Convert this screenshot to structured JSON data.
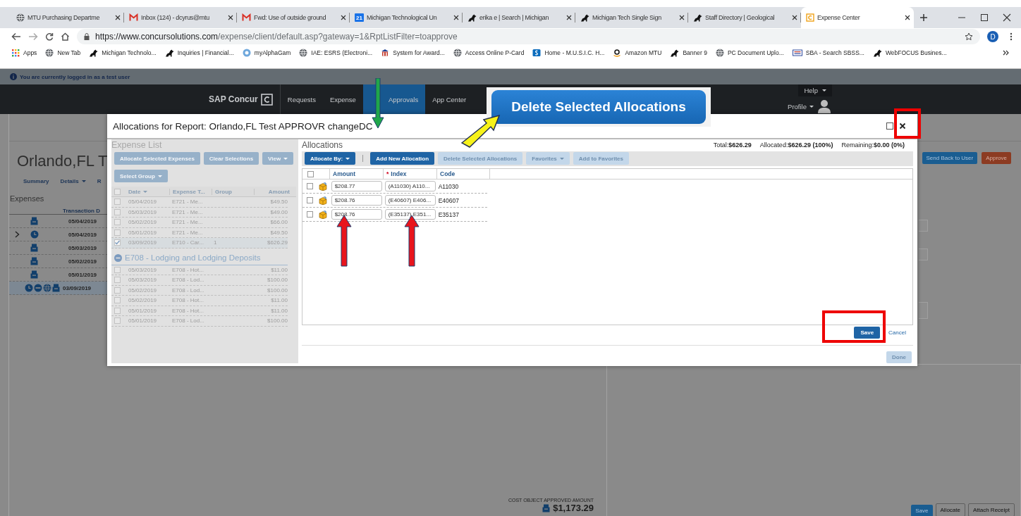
{
  "browser": {
    "tabs": [
      {
        "title": "MTU Purchasing Departme",
        "kind": "globe",
        "selected": false
      },
      {
        "title": "Inbox (124) - dcyrus@mtu",
        "kind": "mail",
        "selected": false
      },
      {
        "title": "Fwd: Use of outside ground",
        "kind": "mail",
        "selected": false
      },
      {
        "title": "Michigan Technological Un",
        "kind": "calendar",
        "badge": "21",
        "selected": false
      },
      {
        "title": "erika e | Search | Michigan",
        "kind": "husky",
        "selected": false
      },
      {
        "title": "Michigan Tech Single Sign",
        "kind": "husky",
        "selected": false
      },
      {
        "title": "Staff Directory | Geological",
        "kind": "husky",
        "selected": false
      },
      {
        "title": "Expense Center",
        "kind": "concur",
        "selected": true
      }
    ],
    "url_host": "https://www.concursolutions.com",
    "url_path": "/expense/client/default.asp?gateway=1&RptListFilter=toapprove",
    "profile_initial": "D",
    "bookmarks": [
      {
        "label": "Apps",
        "kind": "apps"
      },
      {
        "label": "New Tab",
        "kind": "globe"
      },
      {
        "label": "Michigan Technolo...",
        "kind": "husky"
      },
      {
        "label": "Inquiries | Financial...",
        "kind": "husky"
      },
      {
        "label": "myAlphaGam",
        "kind": "badge"
      },
      {
        "label": "IAE: ESRS (Electroni...",
        "kind": "globe"
      },
      {
        "label": "System for Award...",
        "kind": "building"
      },
      {
        "label": "Access Online P-Card",
        "kind": "globe"
      },
      {
        "label": "Home - M.U.S.I.C. H...",
        "kind": "sharepoint"
      },
      {
        "label": "Amazon MTU",
        "kind": "amazon"
      },
      {
        "label": "Banner 9",
        "kind": "husky"
      },
      {
        "label": "PC Document Uplo...",
        "kind": "globe"
      },
      {
        "label": "SBA - Search SBSS...",
        "kind": "sba"
      },
      {
        "label": "WebFOCUS Busines...",
        "kind": "husky"
      }
    ]
  },
  "notice": "You are currently logged in as a test user",
  "nav": {
    "logo": "SAP Concur",
    "items": [
      {
        "label": "Requests",
        "selected": false
      },
      {
        "label": "Expense",
        "selected": false
      },
      {
        "label": "Approvals",
        "selected": true
      },
      {
        "label": "App Center",
        "selected": false
      }
    ],
    "help": "Help",
    "profile": "Profile"
  },
  "report": {
    "title": "Orlando,FL T",
    "tabs": [
      {
        "label": "Summary",
        "dropdown": false
      },
      {
        "label": "Details",
        "dropdown": true
      },
      {
        "label": "R",
        "dropdown": false
      }
    ],
    "actions": [
      {
        "label": "Send Back to User",
        "kind": "primary"
      },
      {
        "label": "Approve",
        "kind": "danger"
      }
    ],
    "section": "Expenses",
    "column": "Transaction D",
    "rows": [
      {
        "date": "05/04/2019",
        "icons": [
          {
            "kind": "receipt"
          }
        ],
        "expandable": false,
        "selected": false
      },
      {
        "date": "05/04/2019",
        "icons": [
          {
            "kind": "card"
          }
        ],
        "expandable": true,
        "selected": false
      },
      {
        "date": "05/03/2019",
        "icons": [
          {
            "kind": "receipt"
          }
        ],
        "expandable": false,
        "selected": false
      },
      {
        "date": "05/02/2019",
        "icons": [
          {
            "kind": "receipt"
          }
        ],
        "expandable": false,
        "selected": false
      },
      {
        "date": "05/01/2019",
        "icons": [
          {
            "kind": "receipt"
          }
        ],
        "expandable": false,
        "selected": false
      },
      {
        "date": "03/09/2019",
        "icons": [
          {
            "kind": "card"
          },
          {
            "kind": "minus"
          },
          {
            "kind": "globe"
          },
          {
            "kind": "receipt"
          }
        ],
        "expandable": false,
        "selected": true
      }
    ],
    "cost_label": "COST OBJECT APPROVED AMOUNT",
    "cost_amount": "$1,173.29",
    "buttons": [
      {
        "label": "Save",
        "kind": "primary"
      },
      {
        "label": "Allocate",
        "kind": "default"
      },
      {
        "label": "Attach Receipt",
        "kind": "default"
      }
    ]
  },
  "dialog": {
    "title": "Allocations for Report: Orlando,FL Test APPROVR changeDC",
    "expense_list": {
      "heading": "Expense List",
      "disabled": true,
      "buttons": [
        {
          "label": "Allocate Selected Expenses",
          "dropdown": false
        },
        {
          "label": "Clear Selections",
          "dropdown": false
        },
        {
          "label": "View",
          "dropdown": true
        },
        {
          "label": "Select Group",
          "dropdown": true
        }
      ],
      "all_checked": false,
      "columns": [
        {
          "label": "Date",
          "sorted": true
        },
        {
          "label": "Expense T...",
          "sorted": false
        },
        {
          "label": "Group",
          "sorted": false
        },
        {
          "label": "Amount",
          "sorted": false
        }
      ],
      "rows": [
        {
          "checked": false,
          "date": "05/04/2019",
          "type": "E721 - Me...",
          "amount": "$49.50"
        },
        {
          "checked": false,
          "date": "05/03/2019",
          "type": "E721 - Me...",
          "amount": "$49.00"
        },
        {
          "checked": false,
          "date": "05/02/2019",
          "type": "E721 - Me...",
          "amount": "$66.00"
        },
        {
          "checked": false,
          "date": "05/01/2019",
          "type": "E721 - Me...",
          "amount": "$49.50"
        },
        {
          "checked": true,
          "date": "03/09/2019",
          "type": "E710 - Car...",
          "group": "1",
          "amount": "$626.29"
        }
      ],
      "group_title": "E708 - Lodging and Lodging Deposits",
      "group_rows": [
        {
          "checked": false,
          "date": "05/03/2019",
          "type": "E708 - Hot...",
          "amount": "$11.00"
        },
        {
          "checked": false,
          "date": "05/03/2019",
          "type": "E708 - Lod...",
          "amount": "$100.00"
        },
        {
          "checked": false,
          "date": "05/02/2019",
          "type": "E708 - Lod...",
          "amount": "$100.00"
        },
        {
          "checked": false,
          "date": "05/02/2019",
          "type": "E708 - Hot...",
          "amount": "$11.00"
        },
        {
          "checked": false,
          "date": "05/01/2019",
          "type": "E708 - Hot...",
          "amount": "$11.00"
        },
        {
          "checked": false,
          "date": "05/01/2019",
          "type": "E708 - Lod...",
          "amount": "$100.00"
        }
      ]
    },
    "allocations": {
      "heading": "Allocations",
      "totals": [
        "Total:**$626.29**",
        "Allocated:**$626.29 (100%)**",
        "Remaining:**$0.00 (0%)**"
      ],
      "toolbar": [
        {
          "label": "Allocate By:",
          "dropdown": true,
          "disabled": false
        },
        {
          "label": "Add New Allocation",
          "dropdown": false,
          "disabled": false
        },
        {
          "label": "Delete Selected Allocations",
          "dropdown": false,
          "disabled": true
        },
        {
          "label": "Favorites",
          "dropdown": true,
          "disabled": true
        },
        {
          "label": "Add to Favorites",
          "dropdown": false,
          "disabled": true
        }
      ],
      "all_checked": false,
      "columns": [
        {
          "label": "Amount"
        },
        {
          "label": "Index",
          "mark": "*"
        },
        {
          "label": "Code"
        }
      ],
      "rows": [
        {
          "checked": false,
          "amount": "$208.77",
          "index": "(A11030) A110...",
          "code": "A11030"
        },
        {
          "checked": false,
          "amount": "$208.76",
          "index": "(E40607) E406...",
          "code": "E40607"
        },
        {
          "checked": false,
          "amount": "$208.76",
          "index": "(E35137) E351...",
          "code": "E35137"
        }
      ],
      "save": "Save",
      "cancel": "Cancel",
      "done": {
        "label": "Done",
        "disabled": true
      }
    }
  },
  "annotations": {
    "callout": "Delete Selected Allocations"
  }
}
